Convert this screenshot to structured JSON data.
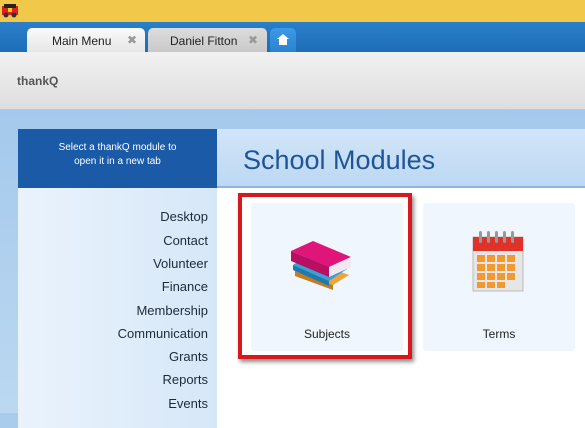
{
  "tabs": [
    {
      "label": "Main Menu",
      "close": "✖"
    },
    {
      "label": "Daniel Fitton",
      "close": "✖"
    }
  ],
  "header": {
    "brand": "thankQ"
  },
  "sidebar": {
    "heading_line1": "Select a thankQ module to",
    "heading_line2": "open it in a new tab",
    "items": [
      {
        "label": "Desktop"
      },
      {
        "label": "Contact"
      },
      {
        "label": "Volunteer"
      },
      {
        "label": "Finance"
      },
      {
        "label": "Membership"
      },
      {
        "label": "Communication"
      },
      {
        "label": "Grants"
      },
      {
        "label": "Reports"
      },
      {
        "label": "Events"
      }
    ]
  },
  "main": {
    "title": "School Modules",
    "tiles": [
      {
        "label": "Subjects",
        "icon": "books-icon"
      },
      {
        "label": "Terms",
        "icon": "calendar-icon"
      }
    ]
  },
  "colors": {
    "tab_strip": "#2a7fc9",
    "sidebar_heading": "#1a5aa6",
    "title": "#1f5597",
    "highlight": "#d7181d"
  }
}
